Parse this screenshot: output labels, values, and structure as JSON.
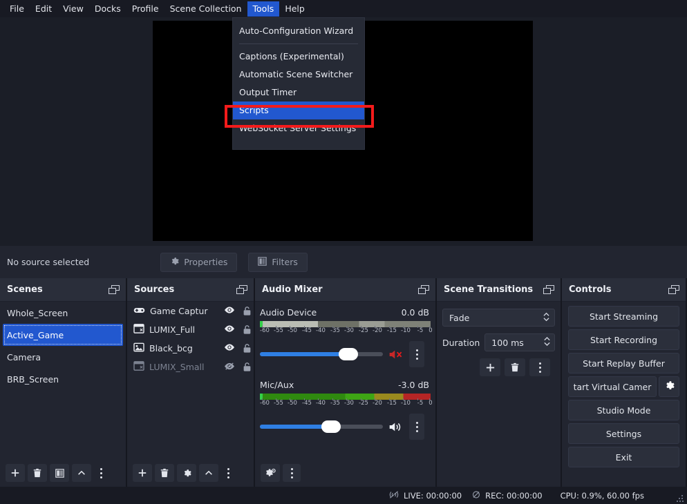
{
  "menubar": {
    "items": [
      {
        "label": "File",
        "active": false
      },
      {
        "label": "Edit",
        "active": false
      },
      {
        "label": "View",
        "active": false
      },
      {
        "label": "Docks",
        "active": false
      },
      {
        "label": "Profile",
        "active": false
      },
      {
        "label": "Scene Collection",
        "active": false
      },
      {
        "label": "Tools",
        "active": true
      },
      {
        "label": "Help",
        "active": false
      }
    ]
  },
  "tools_menu": {
    "items": [
      {
        "label": "Auto-Configuration Wizard",
        "selected": false
      },
      {
        "label": "Captions (Experimental)",
        "selected": false
      },
      {
        "label": "Automatic Scene Switcher",
        "selected": false
      },
      {
        "label": "Output Timer",
        "selected": false
      },
      {
        "label": "Scripts",
        "selected": true
      },
      {
        "label": "WebSocket Server Settings",
        "selected": false
      }
    ],
    "highlight_color": "#f41b1b",
    "selected_color": "#2258cf"
  },
  "source_toolbar": {
    "status_text": "No source selected",
    "properties_label": "Properties",
    "filters_label": "Filters"
  },
  "scenes": {
    "title": "Scenes",
    "items": [
      {
        "label": "Whole_Screen",
        "selected": false
      },
      {
        "label": "Active_Game",
        "selected": true
      },
      {
        "label": "Camera",
        "selected": false
      },
      {
        "label": "BRB_Screen",
        "selected": false
      }
    ]
  },
  "sources": {
    "title": "Sources",
    "items": [
      {
        "label": "Game Captur",
        "icon": "gamepad-icon",
        "visible": true,
        "locked": false,
        "dim": false
      },
      {
        "label": "LUMIX_Full",
        "icon": "window-capture-icon",
        "visible": true,
        "locked": false,
        "dim": false
      },
      {
        "label": "Black_bcg",
        "icon": "image-icon",
        "visible": true,
        "locked": false,
        "dim": false
      },
      {
        "label": "LUMIX_Small",
        "icon": "window-capture-icon",
        "visible": false,
        "locked": false,
        "dim": true
      }
    ]
  },
  "audio_mixer": {
    "title": "Audio Mixer",
    "channels": [
      {
        "name": "Audio Device",
        "db": "0.0 dB",
        "muted": true,
        "volume_percent": 72,
        "meter_percent": 100,
        "meter_style": "inactive"
      },
      {
        "name": "Mic/Aux",
        "db": "-3.0 dB",
        "muted": false,
        "volume_percent": 58,
        "meter_percent": 100,
        "meter_style": "active"
      }
    ],
    "tick_labels": [
      "-60",
      "-55",
      "-50",
      "-45",
      "-40",
      "-35",
      "-30",
      "-25",
      "-20",
      "-15",
      "-10",
      "-5",
      "0"
    ]
  },
  "scene_transitions": {
    "title": "Scene Transitions",
    "transition_value": "Fade",
    "duration_label": "Duration",
    "duration_value": "100 ms"
  },
  "controls": {
    "title": "Controls",
    "buttons": [
      {
        "label": "Start Streaming"
      },
      {
        "label": "Start Recording"
      },
      {
        "label": "Start Replay Buffer"
      },
      {
        "label": "tart Virtual Camer"
      },
      {
        "label": "Studio Mode"
      },
      {
        "label": "Settings"
      },
      {
        "label": "Exit"
      }
    ]
  },
  "status_bar": {
    "live_label": "LIVE: 00:00:00",
    "rec_label": "REC: 00:00:00",
    "cpu_label": "CPU: 0.9%, 60.00 fps"
  }
}
